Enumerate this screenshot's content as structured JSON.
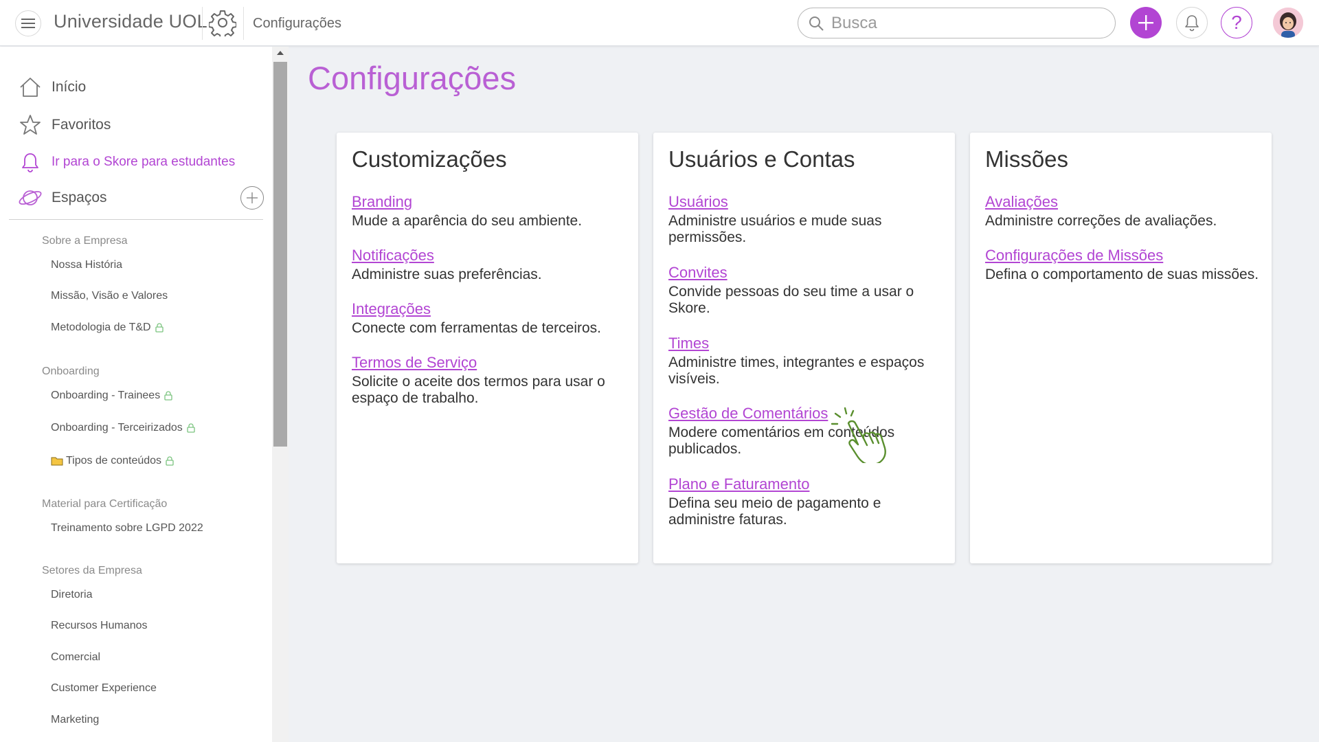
{
  "header": {
    "app_title": "Universidade UOL",
    "breadcrumb": "Configurações",
    "search_placeholder": "Busca",
    "help_label": "?"
  },
  "sidebar": {
    "nav": [
      {
        "label": "Início",
        "icon": "home-icon"
      },
      {
        "label": "Favoritos",
        "icon": "star-icon"
      },
      {
        "label": "Ir para o Skore para estudantes",
        "icon": "bell-icon"
      }
    ],
    "spaces_label": "Espaços",
    "groups": [
      {
        "title": "Sobre a Empresa",
        "items": [
          {
            "label": "Nossa História",
            "locked": false
          },
          {
            "label": "Missão, Visão e Valores",
            "locked": false
          },
          {
            "label": "Metodologia de T&D",
            "locked": true
          }
        ]
      },
      {
        "title": "Onboarding",
        "items": [
          {
            "label": "Onboarding - Trainees",
            "locked": true
          },
          {
            "label": "Onboarding - Terceirizados",
            "locked": true
          },
          {
            "label": "Tipos de conteúdos",
            "locked": true,
            "icon": "folder-icon"
          }
        ]
      },
      {
        "title": "Material para Certificação",
        "items": [
          {
            "label": "Treinamento sobre LGPD 2022",
            "locked": false
          }
        ]
      },
      {
        "title": "Setores da Empresa",
        "items": [
          {
            "label": "Diretoria",
            "locked": false
          },
          {
            "label": "Recursos Humanos",
            "locked": false
          },
          {
            "label": "Comercial",
            "locked": false
          },
          {
            "label": "Customer Experience",
            "locked": false
          },
          {
            "label": "Marketing",
            "locked": false
          }
        ]
      }
    ]
  },
  "main": {
    "title": "Configurações",
    "cards": [
      {
        "title": "Customizações",
        "entries": [
          {
            "link": "Branding",
            "desc": "Mude a aparência do seu ambiente."
          },
          {
            "link": "Notificações",
            "desc": "Administre suas preferências."
          },
          {
            "link": "Integrações",
            "desc": "Conecte com ferramentas de terceiros."
          },
          {
            "link": "Termos de Serviço",
            "desc": "Solicite o aceite dos termos para usar o espaço de trabalho."
          }
        ]
      },
      {
        "title": "Usuários e Contas",
        "entries": [
          {
            "link": "Usuários",
            "desc": "Administre usuários e mude suas permissões."
          },
          {
            "link": "Convites",
            "desc": "Convide pessoas do seu time a usar o Skore."
          },
          {
            "link": "Times",
            "desc": "Administre times, integrantes e espaços visíveis."
          },
          {
            "link": "Gestão de Comentários",
            "desc": "Modere comentários em conteúdos publicados."
          },
          {
            "link": "Plano e Faturamento",
            "desc": "Defina seu meio de pagamento e administre faturas."
          }
        ]
      },
      {
        "title": "Missões",
        "entries": [
          {
            "link": "Avaliações",
            "desc": "Administre correções de avaliações."
          },
          {
            "link": "Configurações de Missões",
            "desc": "Defina o comportamento de suas missões."
          }
        ]
      }
    ]
  },
  "colors": {
    "accent": "#b245d3",
    "title_purple": "#b960d4",
    "cursor_green": "#5a8f2e",
    "background": "#eff1f4"
  }
}
